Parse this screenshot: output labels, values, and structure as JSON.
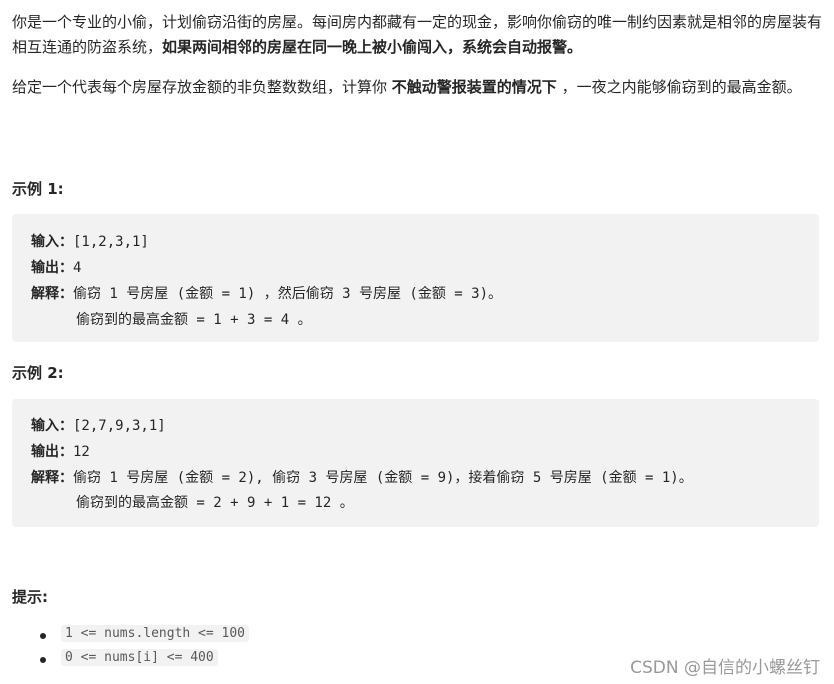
{
  "description": {
    "p1_a": "你是一个专业的小偷，计划偷窃沿街的房屋。每间房内都藏有一定的现金，影响你偷窃的唯一制约因素就是相邻的房屋装有相互连通的防盗系统，",
    "p1_b": "如果两间相邻的房屋在同一晚上被小偷闯入，系统会自动报警。",
    "p2_a": "给定一个代表每个房屋存放金额的非负整数数组，计算你 ",
    "p2_b": "不触动警报装置的情况下",
    "p2_c": " ，一夜之内能够偷窃到的最高金额。"
  },
  "examples": [
    {
      "title": "示例 1:",
      "input_label": "输入：",
      "input": "[1,2,3,1]",
      "output_label": "输出：",
      "output": "4",
      "explain_label": "解释：",
      "explain1": "偷窃 1 号房屋 (金额 = 1) ，然后偷窃 3 号房屋 (金额 = 3)。",
      "explain2": "偷窃到的最高金额 = 1 + 3 = 4 。"
    },
    {
      "title": "示例 2:",
      "input_label": "输入：",
      "input": "[2,7,9,3,1]",
      "output_label": "输出：",
      "output": "12",
      "explain_label": "解释：",
      "explain1": "偷窃 1 号房屋 (金额 = 2), 偷窃 3 号房屋 (金额 = 9)，接着偷窃 5 号房屋 (金额 = 1)。",
      "explain2": "偷窃到的最高金额 = 2 + 9 + 1 = 12 。"
    }
  ],
  "hints": {
    "title": "提示:",
    "items": [
      "1 <= nums.length <= 100",
      "0 <= nums[i] <= 400"
    ]
  },
  "watermark": "CSDN @自信的小螺丝钉"
}
